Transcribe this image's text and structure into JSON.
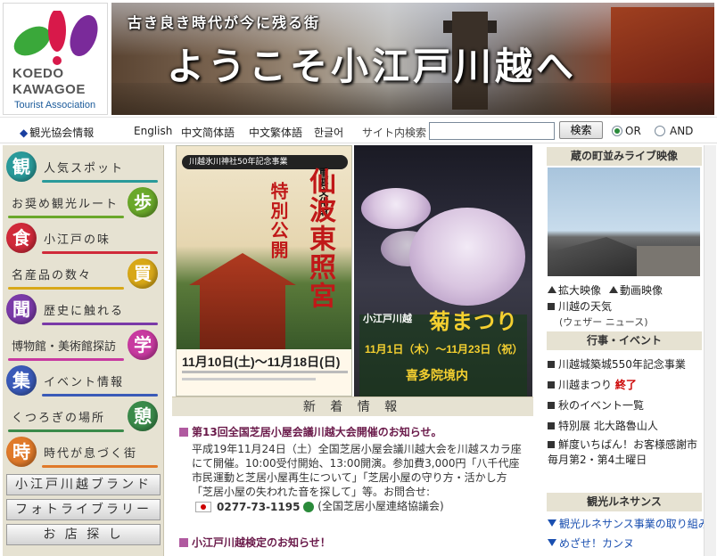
{
  "header": {
    "logo": {
      "line1_a": "KOEDO",
      "line1_o": "",
      "line2": "KAWAGOE",
      "line3": "Tourist Association"
    },
    "banner": {
      "catch": "古き良き時代が今に残る街",
      "title": "ようこそ小江戸川越へ"
    }
  },
  "nav": {
    "assoc": "観光協会情報",
    "english": "English",
    "zh_simplified": "中文简体語",
    "zh_traditional": "中文繁体語",
    "korean": "한글어",
    "search_label": "サイト内検索",
    "search_value": "",
    "search_button": "検索",
    "radio_or": "OR",
    "radio_and": "AND"
  },
  "left_menu": {
    "items": [
      {
        "char": "観",
        "label": "人気スポット",
        "color": "#2a9a9a"
      },
      {
        "char": "歩",
        "label": "お奨め観光ルート",
        "color": "#6aa82a"
      },
      {
        "char": "食",
        "label": "小江戸の味",
        "color": "#d02a3a"
      },
      {
        "char": "買",
        "label": "名産品の数々",
        "color": "#d8a818"
      },
      {
        "char": "聞",
        "label": "歴史に触れる",
        "color": "#7a3aa8"
      },
      {
        "char": "学",
        "label": "博物館・美術館探訪",
        "color": "#c83aa0"
      },
      {
        "char": "集",
        "label": "イベント情報",
        "color": "#3a5ab8"
      },
      {
        "char": "憩",
        "label": "くつろぎの場所",
        "color": "#3a8a4a"
      },
      {
        "char": "時",
        "label": "時代が息づく街",
        "color": "#e07a2a"
      }
    ],
    "buttons": [
      "小江戸川越ブランド",
      "フォトライブラリー",
      "お 店 探 し"
    ]
  },
  "promo": {
    "poster1": {
      "head": "川越氷川神社50年記念事業",
      "title": "仙波東照宮",
      "subtitle": "特別公開",
      "tag": "重要文化財",
      "dates": "11月10日(土)〜11月18日(日)"
    },
    "poster2": {
      "small": "小江戸川越",
      "title": "菊まつり",
      "dates": "11月1日（木）〜11月23日（祝）",
      "venue": "喜多院境内"
    }
  },
  "news": {
    "heading": "新 着 情 報",
    "items": [
      {
        "title": "第13回全国芝居小屋会議川越大会開催のお知らせ。",
        "body": "平成19年11月24日（土）全国芝居小屋会議川越大会を川越スカラ座にて開催。10:00受付開始、13:00開演。参加費3,000円「八千代座市民運動と芝居小屋再生について」「芝居小屋の守り方・活かし方「芝居小屋の失われた音を探して」等。お問合せ:",
        "phone": "0277-73-1195",
        "contact": "(全国芝居小屋連絡協議会)"
      },
      {
        "title": "小江戸川越検定のお知らせ！"
      }
    ]
  },
  "right": {
    "live_heading": "蔵の町並みライブ映像",
    "live_links": [
      "拡大映像",
      "動画映像"
    ],
    "weather": "川越の天気",
    "weather_sub": "(ウェザー ニュース)",
    "events_heading": "行事・イベント",
    "events": [
      {
        "label": "川越城築城550年記念事業",
        "badge": ""
      },
      {
        "label": "川越まつり",
        "badge": "終了"
      },
      {
        "label": "秋のイベント一覧",
        "badge": ""
      },
      {
        "label": "特別展 北大路魯山人",
        "badge": ""
      },
      {
        "label": "鮮度いちばん！お客様感謝市 毎月第2・第4土曜日",
        "badge": ""
      }
    ],
    "renaissance_heading": "観光ルネサンス",
    "renaissance": [
      "観光ルネサンス事業の取り組み",
      "めざせ！カンヌ"
    ]
  }
}
